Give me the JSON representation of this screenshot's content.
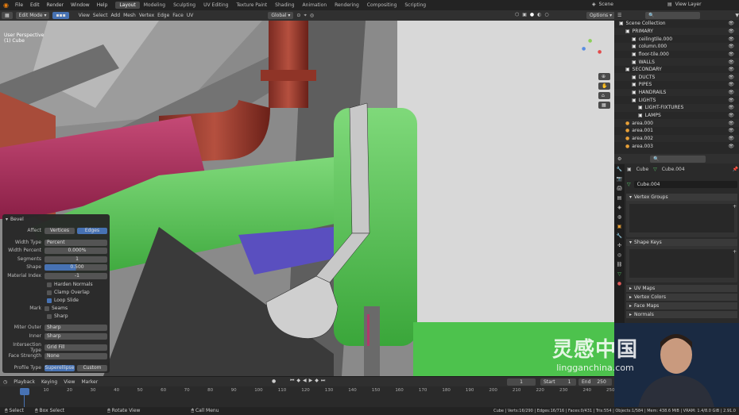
{
  "topbar": {
    "menu": [
      "File",
      "Edit",
      "Render",
      "Window",
      "Help"
    ],
    "workspaces": [
      "Layout",
      "Modeling",
      "Sculpting",
      "UV Editing",
      "Texture Paint",
      "Shading",
      "Animation",
      "Rendering",
      "Compositing",
      "Scripting"
    ],
    "scene": "Scene",
    "view_layer": "View Layer"
  },
  "header": {
    "mode": "Edit Mode",
    "menus": [
      "View",
      "Select",
      "Add",
      "Mesh",
      "Vertex",
      "Edge",
      "Face",
      "UV"
    ],
    "orientation": "Global",
    "options": "Options"
  },
  "viewport": {
    "perspective": "User Perspective",
    "object": "(1) Cube"
  },
  "outliner": {
    "rows": [
      "Scene Collection",
      "PRIMARY",
      "ceilingtile.000",
      "column.000",
      "floor-tile.000",
      "WALLS",
      "SECONDARY",
      "DUCTS",
      "PIPES",
      "HANDRAILS",
      "LIGHTS",
      "LIGHT-FIXTURES",
      "LAMPS",
      "area.000",
      "area.001",
      "area.002",
      "area.003"
    ]
  },
  "properties": {
    "object": "Cube",
    "mesh": "Cube.004",
    "mesh_field": "Cube.004",
    "panels": [
      "Vertex Groups",
      "Shape Keys",
      "UV Maps",
      "Vertex Colors",
      "Face Maps",
      "Normals"
    ]
  },
  "bevel": {
    "title": "Bevel",
    "affect_label": "Affect",
    "affect_options": [
      "Vertices",
      "Edges"
    ],
    "width_type_label": "Width Type",
    "width_type": "Percent",
    "width_percent_label": "Width Percent",
    "width_percent": "0.000%",
    "segments_label": "Segments",
    "segments": "1",
    "shape_label": "Shape",
    "shape": "0.500",
    "material_label": "Material Index",
    "material": "-1",
    "checks": [
      "Harden Normals",
      "Clamp Overlap",
      "Loop Slide"
    ],
    "mark_label": "Mark",
    "mark_checks": [
      "Seams",
      "Sharp"
    ],
    "miter_outer_label": "Miter Outer",
    "miter_outer": "Sharp",
    "inner_label": "Inner",
    "inner": "Sharp",
    "intersection_label": "Intersection Type",
    "intersection": "Grid Fill",
    "face_strength_label": "Face Strength",
    "face_strength": "None",
    "profile_label": "Profile Type",
    "profile_options": [
      "Superellipse",
      "Custom"
    ]
  },
  "timeline": {
    "menus": [
      "Playback",
      "Keying",
      "View",
      "Marker"
    ],
    "current": "1",
    "start_label": "Start",
    "start": "1",
    "end_label": "End",
    "end": "250",
    "ticks": [
      "1",
      "10",
      "20",
      "30",
      "40",
      "50",
      "60",
      "70",
      "80",
      "90",
      "100",
      "110",
      "120",
      "130",
      "140",
      "150",
      "160",
      "170",
      "180",
      "190",
      "200",
      "210",
      "220",
      "230",
      "240",
      "250"
    ]
  },
  "status": {
    "items": [
      "Select",
      "Box Select",
      "Rotate View",
      "Call Menu"
    ],
    "stats": "Cube | Verts:16/290 | Edges:16/716 | Faces:0/431 | Tris:554 | Objects:1/584 | Mem: 438.6 MiB | VRAM: 1.4/8.0 GiB | 2.91.0"
  },
  "watermark": {
    "cn": "灵感中国",
    "en": "lingganchina.com"
  }
}
